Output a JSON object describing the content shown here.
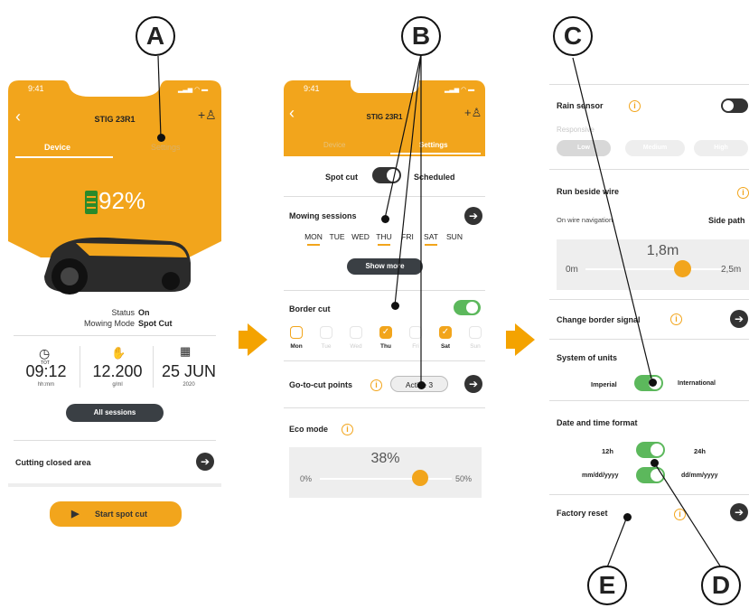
{
  "callouts": {
    "a": "A",
    "b": "B",
    "c": "C",
    "d": "D",
    "e": "E"
  },
  "phone1": {
    "time": "9:41",
    "title": "STIG 23R1",
    "tab_device": "Device",
    "tab_settings": "Settings",
    "battery": "92%",
    "status_label": "Status",
    "status_value": "On",
    "mode_label": "Mowing Mode",
    "mode_value": "Spot Cut",
    "stat1_value": "09:12",
    "stat1_unit": "hh:mm",
    "stat1_icon_label": "TOT",
    "stat2_value": "12.200",
    "stat2_unit": "g/ml",
    "stat3_value": "25 JUN",
    "stat3_unit": "2020",
    "all_sessions": "All sessions",
    "cutting_closed": "Cutting closed area",
    "start_spot": "Start spot cut"
  },
  "phone2": {
    "time": "9:41",
    "title": "STIG 23R1",
    "tab_device": "Device",
    "tab_settings": "Settings",
    "spot_cut": "Spot cut",
    "scheduled": "Scheduled",
    "mowing_sessions": "Mowing sessions",
    "days": [
      "MON",
      "TUE",
      "WED",
      "THU",
      "FRI",
      "SAT",
      "SUN"
    ],
    "show_more": "Show more",
    "border_cut": "Border cut",
    "days_short": [
      "Mon",
      "Tue",
      "Wed",
      "Thu",
      "Fri",
      "Sat",
      "Sun"
    ],
    "go_to_cut": "Go-to-cut points",
    "active": "Active 3",
    "eco_mode": "Eco mode",
    "eco_value": "38%",
    "eco_min": "0%",
    "eco_max": "50%",
    "eco_level_percent": 38
  },
  "phone3": {
    "rain_sensor": "Rain sensor",
    "responsive": "Responsive",
    "low": "Low",
    "medium": "Medium",
    "high": "High",
    "run_beside": "Run beside wire",
    "on_wire_nav": "On wire navigation",
    "side_path": "Side path",
    "distance_value": "1,8m",
    "distance_min": "0m",
    "distance_max": "2,5m",
    "change_border": "Change border signal",
    "units": "System of units",
    "imperial": "Imperial",
    "international": "International",
    "date_time": "Date and time format",
    "h12": "12h",
    "h24": "24h",
    "date1": "mm/dd/yyyy",
    "date2": "dd/mm/yyyy",
    "factory_reset": "Factory reset"
  },
  "colors": {
    "accent": "#f2a51c",
    "toggle_on": "#5cb85c",
    "dark": "#333333"
  }
}
